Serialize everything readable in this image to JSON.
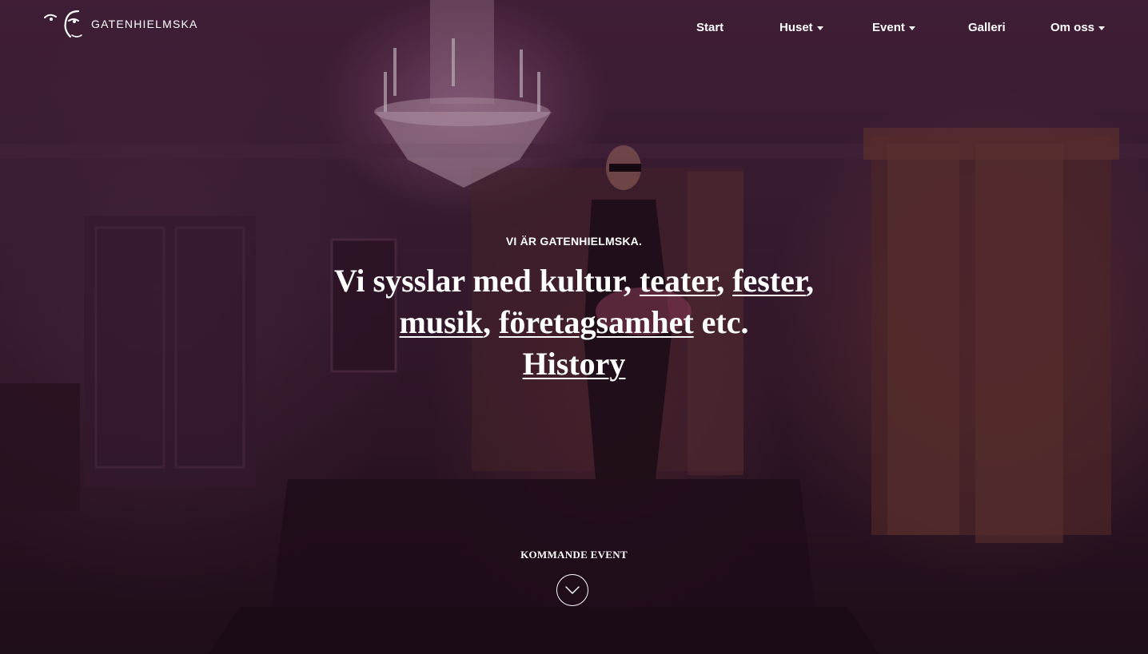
{
  "brand": {
    "name": "GATENHIELMSKA"
  },
  "nav": {
    "items": [
      {
        "label": "Start",
        "has_dropdown": false
      },
      {
        "label": "Huset",
        "has_dropdown": true
      },
      {
        "label": "Event",
        "has_dropdown": true
      },
      {
        "label": "Galleri",
        "has_dropdown": false
      },
      {
        "label": "Om oss",
        "has_dropdown": true
      }
    ]
  },
  "hero": {
    "eyebrow": "VI ÄR GATENHIELMSKA.",
    "headline_intro": "Vi sysslar med kultur,",
    "links": [
      "teater",
      "fester",
      "musik",
      "företagsamhet",
      "History"
    ],
    "separator": ",",
    "suffix": "etc."
  },
  "upcoming": {
    "label": "KOMMANDE EVENT",
    "icon": "chevron-down-icon"
  },
  "colors": {
    "text": "#ffffff",
    "background": "#3d1f36"
  }
}
